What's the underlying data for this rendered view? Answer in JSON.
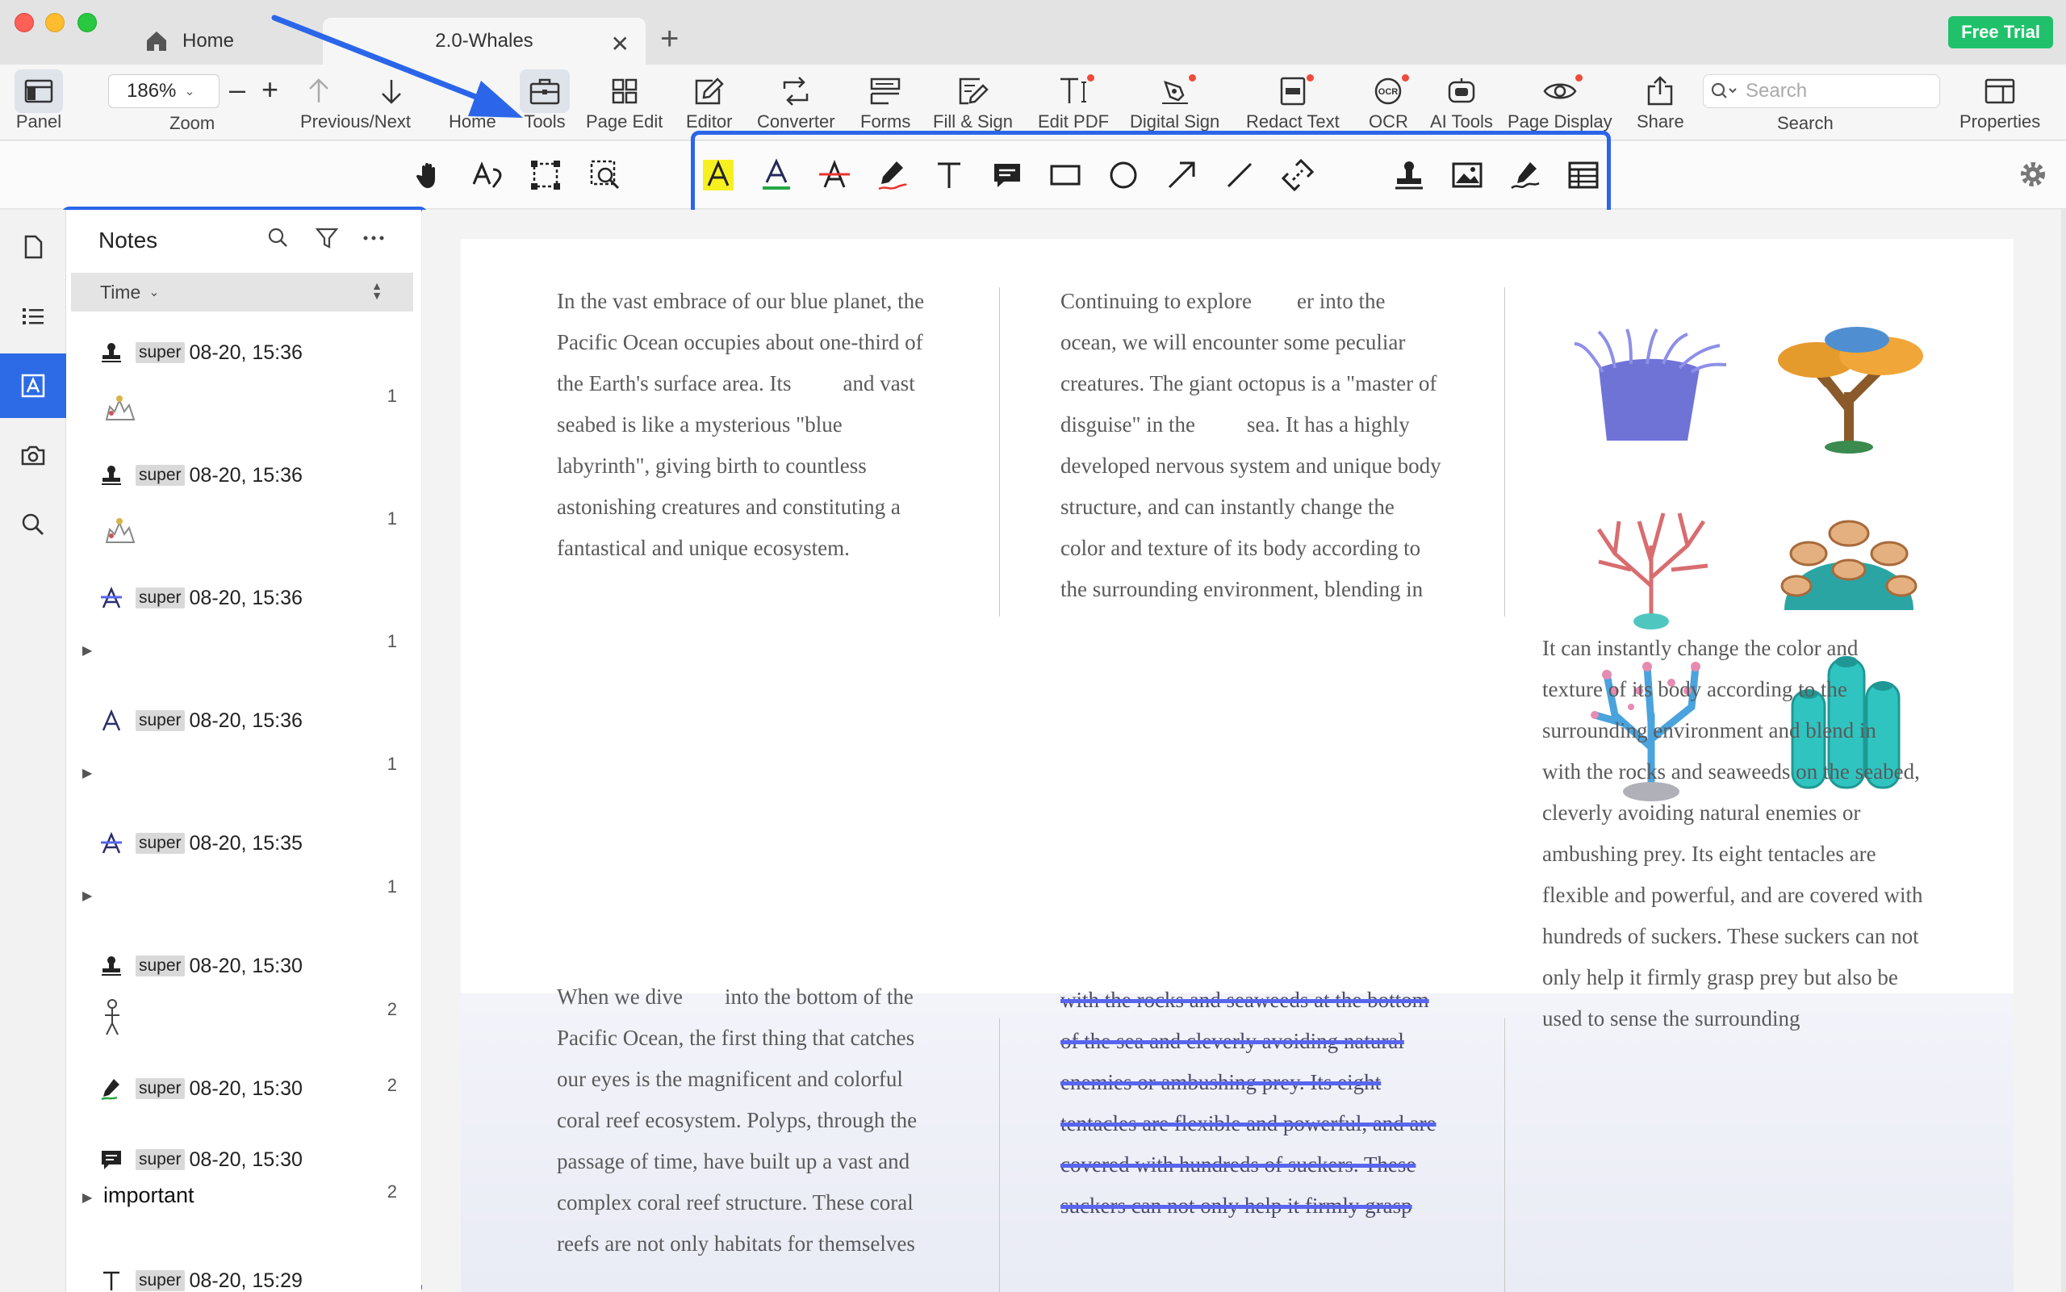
{
  "window": {
    "tabs": [
      {
        "label": "Home"
      },
      {
        "label": "2.0-Whales"
      }
    ],
    "free_trial": "Free Trial"
  },
  "toolbar": {
    "panel": "Panel",
    "zoom_value": "186%",
    "zoom_label": "Zoom",
    "prevnext": "Previous/Next",
    "home": "Home",
    "tools": "Tools",
    "page_edit": "Page Edit",
    "editor": "Editor",
    "converter": "Converter",
    "forms": "Forms",
    "fill_sign": "Fill & Sign",
    "edit_pdf": "Edit PDF",
    "digital_sign": "Digital Sign",
    "redact_text": "Redact Text",
    "ocr": "OCR",
    "ai_tools": "AI Tools",
    "page_display": "Page Display",
    "share": "Share",
    "search_placeholder": "Search",
    "search_label": "Search",
    "properties": "Properties"
  },
  "notes_panel": {
    "title": "Notes",
    "sort_label": "Time",
    "items": [
      {
        "icon": "stamp-icon",
        "author": "super",
        "time": "08-20, 15:36",
        "count": "1"
      },
      {
        "icon": "stamp-icon",
        "author": "super",
        "time": "08-20, 15:36",
        "count": "1"
      },
      {
        "icon": "strikethrough-icon",
        "author": "super",
        "time": "08-20, 15:36",
        "count": "1"
      },
      {
        "icon": "text-icon",
        "author": "super",
        "time": "08-20, 15:36",
        "count": "1"
      },
      {
        "icon": "strikethrough-icon",
        "author": "super",
        "time": "08-20, 15:35",
        "count": "1"
      },
      {
        "icon": "stamp-icon",
        "author": "super",
        "time": "08-20, 15:30",
        "count": "2"
      },
      {
        "icon": "pen-icon",
        "author": "super",
        "time": "08-20, 15:30",
        "count": "2"
      },
      {
        "icon": "comment-icon",
        "author": "super",
        "time": "08-20, 15:30",
        "count": "2",
        "text": "important"
      },
      {
        "icon": "typewriter-icon",
        "author": "super",
        "time": "08-20, 15:29"
      }
    ]
  },
  "document": {
    "col1_top": [
      "In the vast embrace of our blue planet, the",
      "Pacific Ocean occupies about one-third of",
      "the Earth's surface area. Its",
      "and vast",
      "seabed is like a mysterious \"blue",
      "labyrinth\", giving birth to countless",
      "astonishing creatures and constituting a",
      "fantastical and unique ecosystem."
    ],
    "col2_top": [
      "Continuing to explore",
      "er into the",
      "ocean, we will encounter some peculiar",
      "creatures. The giant octopus is a \"master of",
      "disguise\" in the",
      "sea. It has a highly",
      "developed nervous system and unique body",
      "structure, and can instantly change the",
      "color and texture of its body according to",
      "the surrounding environment, blending in"
    ],
    "col3": [
      "It can instantly change the color and",
      "texture of its body according to the",
      "surrounding environment and blend in",
      "with the rocks and seaweeds on the seabed,",
      "cleverly avoiding natural enemies or",
      "ambushing prey. Its eight tentacles are",
      "flexible and powerful, and are covered with",
      "hundreds of suckers. These suckers can not",
      "only help it firmly grasp prey but also be",
      "used to sense the surrounding"
    ],
    "col1_bottom": [
      "When we dive",
      "into the bottom of the",
      "Pacific Ocean, the first thing that catches",
      "our eyes is the magnificent and colorful",
      "coral reef ecosystem. Polyps, through the",
      "passage of time, have built up a vast and",
      "complex coral reef structure. These coral",
      "reefs are not only habitats for themselves"
    ],
    "col2_bottom_struck": [
      "with the rocks and seaweeds at the bottom",
      "of the sea and cleverly avoiding natural",
      "enemies or ambushing prey. Its eight",
      "tentacles are flexible and powerful, and are",
      "covered with hundreds of suckers. These",
      "suckers can not only help it firmly grasp"
    ]
  },
  "colors": {
    "accent_blue": "#2b66ea",
    "free_trial_green": "#21c16b",
    "highlight_yellow": "#f7f020",
    "strike_blue": "#5865ee"
  }
}
